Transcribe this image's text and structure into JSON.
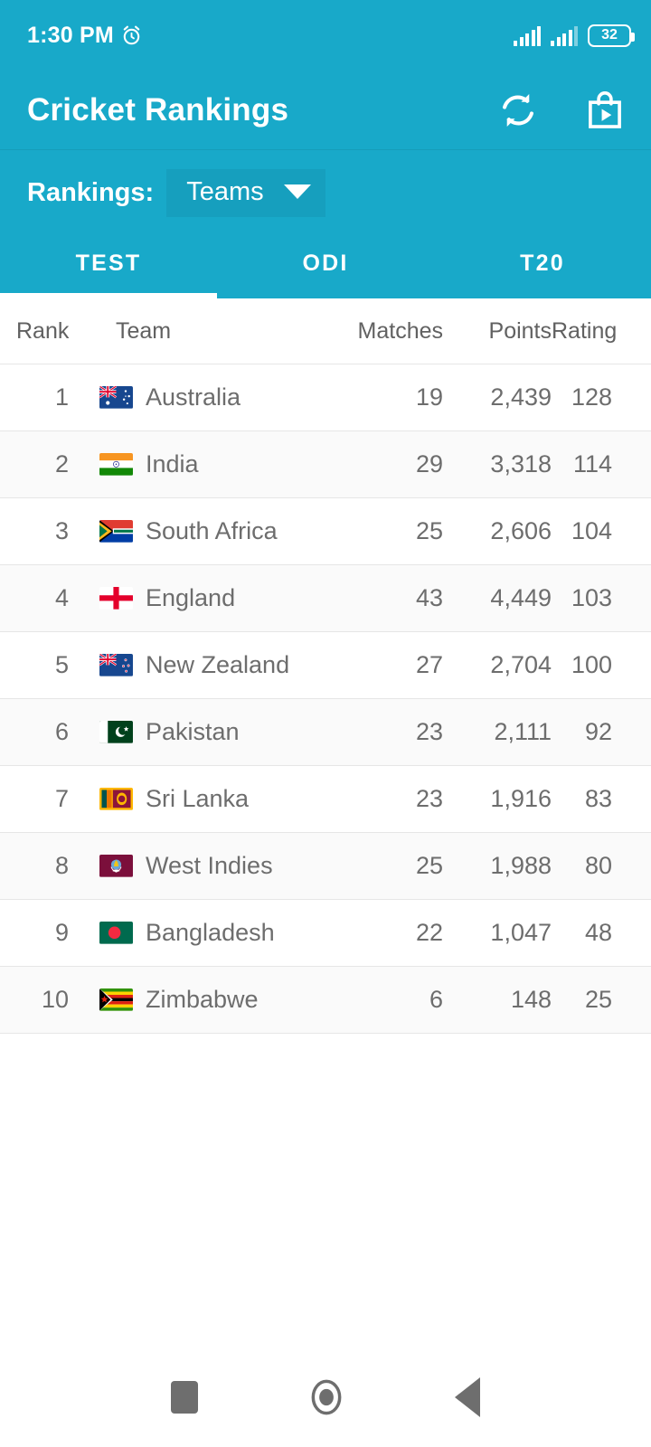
{
  "status_bar": {
    "time": "1:30 PM",
    "alarm_icon": "alarm-clock-icon",
    "signal_1_icon": "signal-bars-icon",
    "signal_2_icon": "signal-bars-icon",
    "battery_level": "32"
  },
  "app_bar": {
    "title": "Cricket Rankings",
    "refresh_icon": "refresh-sync-icon",
    "store_icon": "play-store-bag-icon"
  },
  "selector": {
    "label": "Rankings:",
    "selected": "Teams",
    "caret_icon": "chevron-down-icon"
  },
  "tabs": {
    "items": [
      {
        "label": "TEST",
        "active": true
      },
      {
        "label": "ODI",
        "active": false
      },
      {
        "label": "T20",
        "active": false
      }
    ]
  },
  "table": {
    "columns": [
      "Rank",
      "Team",
      "Matches",
      "Points",
      "Rating"
    ],
    "rows": [
      {
        "rank": "1",
        "team": "Australia",
        "flag": "flag-australia",
        "matches": "19",
        "points": "2,439",
        "rating": "128"
      },
      {
        "rank": "2",
        "team": "India",
        "flag": "flag-india",
        "matches": "29",
        "points": "3,318",
        "rating": "114"
      },
      {
        "rank": "3",
        "team": "South Africa",
        "flag": "flag-south-africa",
        "matches": "25",
        "points": "2,606",
        "rating": "104"
      },
      {
        "rank": "4",
        "team": "England",
        "flag": "flag-england",
        "matches": "43",
        "points": "4,449",
        "rating": "103"
      },
      {
        "rank": "5",
        "team": "New Zealand",
        "flag": "flag-new-zealand",
        "matches": "27",
        "points": "2,704",
        "rating": "100"
      },
      {
        "rank": "6",
        "team": "Pakistan",
        "flag": "flag-pakistan",
        "matches": "23",
        "points": "2,111",
        "rating": "92"
      },
      {
        "rank": "7",
        "team": "Sri Lanka",
        "flag": "flag-sri-lanka",
        "matches": "23",
        "points": "1,916",
        "rating": "83"
      },
      {
        "rank": "8",
        "team": "West Indies",
        "flag": "flag-west-indies",
        "matches": "25",
        "points": "1,988",
        "rating": "80"
      },
      {
        "rank": "9",
        "team": "Bangladesh",
        "flag": "flag-bangladesh",
        "matches": "22",
        "points": "1,047",
        "rating": "48"
      },
      {
        "rank": "10",
        "team": "Zimbabwe",
        "flag": "flag-zimbabwe",
        "matches": "6",
        "points": "148",
        "rating": "25"
      }
    ]
  },
  "nav_bar": {
    "recents_icon": "recents-square-icon",
    "home_icon": "home-circle-icon",
    "back_icon": "back-triangle-icon"
  },
  "colors": {
    "brand_teal": "#18a9c9",
    "row_alt": "#fafafa",
    "text_gray": "#6d6d6d"
  }
}
